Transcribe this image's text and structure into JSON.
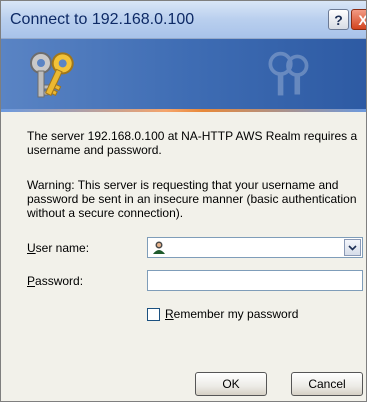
{
  "window": {
    "title": "Connect to 192.168.0.100",
    "help_button": "?",
    "close_button": "X"
  },
  "banner": {
    "icon": "keys-icon"
  },
  "message": {
    "line1": "The server 192.168.0.100 at NA-HTTP AWS Realm requires a username and password.",
    "warning": "Warning: This server is requesting that your username and password be sent in an insecure manner (basic authentication without a secure connection)."
  },
  "form": {
    "username_label_prefix": "U",
    "username_label_rest": "ser name:",
    "username_value": "",
    "password_label_prefix": "P",
    "password_label_rest": "assword:",
    "password_value": "",
    "remember_label_prefix": "R",
    "remember_label_rest": "emember my password",
    "remember_checked": false
  },
  "buttons": {
    "ok": "OK",
    "cancel": "Cancel"
  },
  "colors": {
    "title_text": "#0e2a66",
    "banner_blue": "#3f6db4",
    "accent_orange": "#e8893a"
  }
}
